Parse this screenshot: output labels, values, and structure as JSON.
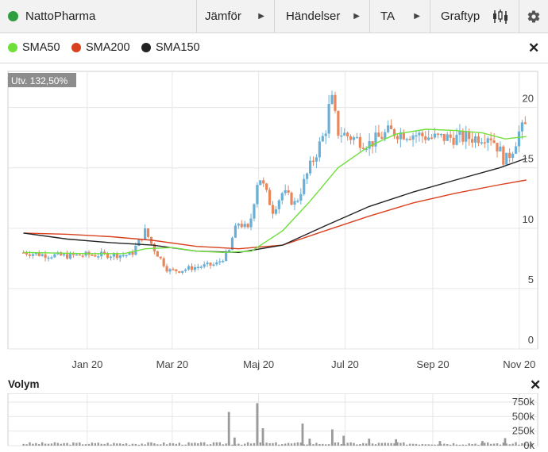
{
  "toolbar": {
    "company": "NattoPharma",
    "compare_label": "Jämför",
    "events_label": "Händelser",
    "ta_label": "TA",
    "chart_type_label": "Graftyp"
  },
  "legend": {
    "items": [
      {
        "label": "SMA50",
        "color": "#6fe03a"
      },
      {
        "label": "SMA200",
        "color": "#d9401e"
      },
      {
        "label": "SMA150",
        "color": "#222222"
      }
    ]
  },
  "change_badge": "Utv. 132,50%",
  "volume_label": "Volym",
  "colors": {
    "up": "#6aafd6",
    "down": "#e8875c",
    "volume": "#9a9a9a"
  },
  "chart_data": {
    "type": "line",
    "title": "",
    "x_ticks": [
      "Jan 20",
      "Mar 20",
      "Maj 20",
      "Jul 20",
      "Sep 20",
      "Nov 20"
    ],
    "y_ticks": [
      0,
      5,
      10,
      15,
      20
    ],
    "ylim": [
      0,
      23
    ],
    "volume_ticks": [
      "750k",
      "500k",
      "250k",
      "0k"
    ],
    "volume_ylim": [
      0,
      900
    ],
    "grid": true,
    "price": {
      "x": [
        "2019-12-01",
        "2019-12-15",
        "2019-12-31",
        "2020-01-15",
        "2020-02-01",
        "2020-02-15",
        "2020-02-25",
        "2020-03-01",
        "2020-03-12",
        "2020-03-20",
        "2020-04-01",
        "2020-04-15",
        "2020-04-24",
        "2020-04-27",
        "2020-05-01",
        "2020-05-08",
        "2020-05-15",
        "2020-05-25",
        "2020-06-01",
        "2020-06-10",
        "2020-06-20",
        "2020-07-01",
        "2020-07-05",
        "2020-07-10",
        "2020-07-20",
        "2020-08-01",
        "2020-08-15",
        "2020-09-01",
        "2020-09-15",
        "2020-10-01",
        "2020-10-15",
        "2020-10-25",
        "2020-11-01",
        "2020-11-05",
        "2020-11-10",
        "2020-11-15",
        "2020-11-20"
      ],
      "y": [
        8.0,
        7.8,
        7.7,
        7.8,
        7.8,
        7.8,
        9.8,
        8.5,
        6.5,
        6.5,
        6.8,
        7,
        8.0,
        9.5,
        10.5,
        9.8,
        14.5,
        11.5,
        13,
        12,
        15,
        18,
        21,
        18,
        17.5,
        17,
        18,
        17.8,
        17.5,
        17.5,
        17.5,
        17.8,
        16.5,
        15.5,
        16.5,
        18,
        18.5
      ]
    },
    "sma50": {
      "x": [
        "2019-12-01",
        "2020-01-15",
        "2020-02-10",
        "2020-02-25",
        "2020-03-15",
        "2020-04-01",
        "2020-04-20",
        "2020-05-10",
        "2020-06-01",
        "2020-06-20",
        "2020-07-10",
        "2020-08-01",
        "2020-08-20",
        "2020-09-10",
        "2020-10-01",
        "2020-10-20",
        "2020-11-05",
        "2020-11-20"
      ],
      "y": [
        8.0,
        7.9,
        7.9,
        8.3,
        8.4,
        8.1,
        8.0,
        8.1,
        9.8,
        12.2,
        15.0,
        16.8,
        17.8,
        18.2,
        18.1,
        17.9,
        17.4,
        17.6
      ]
    },
    "sma200": {
      "x": [
        "2019-12-01",
        "2020-01-01",
        "2020-02-01",
        "2020-03-01",
        "2020-04-01",
        "2020-05-01",
        "2020-06-01",
        "2020-07-01",
        "2020-08-01",
        "2020-09-01",
        "2020-10-01",
        "2020-11-01",
        "2020-11-20"
      ],
      "y": [
        9.6,
        9.5,
        9.3,
        9.0,
        8.5,
        8.3,
        8.6,
        9.8,
        11.0,
        12.1,
        12.9,
        13.6,
        14.0
      ]
    },
    "sma150": {
      "x": [
        "2019-12-01",
        "2020-01-01",
        "2020-02-01",
        "2020-03-01",
        "2020-04-01",
        "2020-05-01",
        "2020-06-01",
        "2020-07-01",
        "2020-08-01",
        "2020-09-01",
        "2020-10-01",
        "2020-11-01",
        "2020-11-20"
      ],
      "y": [
        9.6,
        9.1,
        8.8,
        8.6,
        8.1,
        8.0,
        8.6,
        10.2,
        11.8,
        13.0,
        14.0,
        15.0,
        15.8
      ]
    },
    "volume": {
      "x": [
        "2020-04-24",
        "2020-04-28",
        "2020-05-14",
        "2020-05-18",
        "2020-06-15",
        "2020-06-20",
        "2020-07-06",
        "2020-07-14",
        "2020-08-01",
        "2020-08-20",
        "2020-09-20",
        "2020-10-20",
        "2020-11-05"
      ],
      "values": [
        580,
        140,
        730,
        300,
        380,
        120,
        280,
        170,
        120,
        110,
        80,
        80,
        130
      ]
    }
  }
}
